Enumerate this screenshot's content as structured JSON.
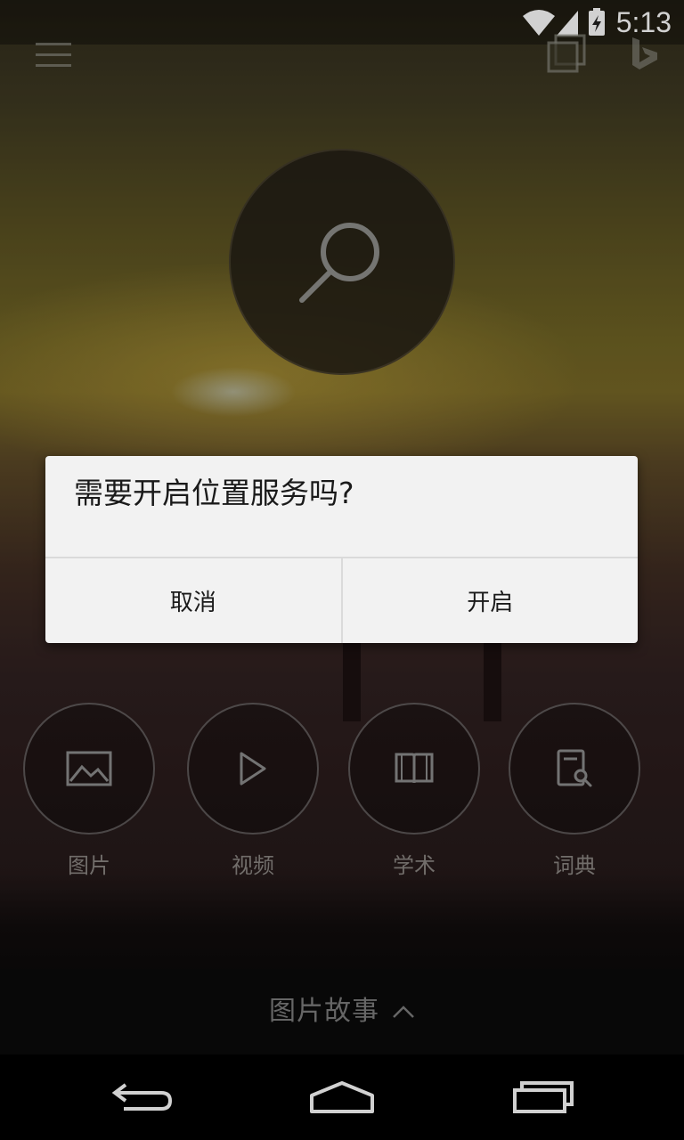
{
  "status_bar": {
    "time": "5:13",
    "icons": [
      "wifi-icon",
      "cell-signal-icon",
      "battery-charging-icon"
    ]
  },
  "app_bar": {
    "icons": [
      "menu-icon",
      "tabs-icon",
      "bing-logo-icon"
    ]
  },
  "search": {
    "icon": "search-icon"
  },
  "categories": [
    {
      "label": "图片",
      "icon": "image-icon"
    },
    {
      "label": "视频",
      "icon": "play-icon"
    },
    {
      "label": "学术",
      "icon": "book-icon"
    },
    {
      "label": "词典",
      "icon": "dictionary-icon"
    }
  ],
  "bottom": {
    "story_label": "图片故事",
    "chevron_icon": "chevron-up-icon"
  },
  "nav_bar": {
    "icons": [
      "back-icon",
      "home-icon",
      "recents-icon"
    ]
  },
  "dialog": {
    "title": "需要开启位置服务吗?",
    "cancel_label": "取消",
    "confirm_label": "开启"
  },
  "colors": {
    "dialog_bg": "#f2f2f2",
    "dialog_text": "#1a1a1a",
    "category_label": "#8a8582",
    "story_label": "#7d7d7d"
  }
}
